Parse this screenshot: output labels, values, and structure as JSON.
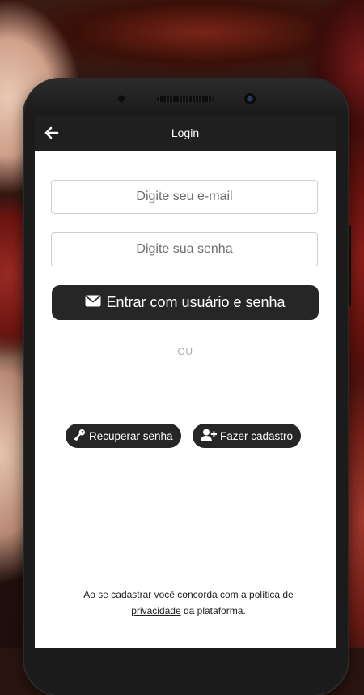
{
  "appbar": {
    "title": "Login",
    "back_icon": "arrow-left-icon"
  },
  "form": {
    "email_placeholder": "Digite seu e-mail",
    "password_placeholder": "Digite sua senha",
    "login_button": "Entrar com usuário e senha",
    "login_icon": "envelope-icon",
    "divider_text": "OU"
  },
  "actions": {
    "recover_label": "Recuperar senha",
    "recover_icon": "key-icon",
    "signup_label": "Fazer cadastro",
    "signup_icon": "user-plus-icon"
  },
  "terms": {
    "prefix": "Ao se cadastrar você concorda com a ",
    "link": "política de privacidade",
    "suffix": " da plataforma."
  },
  "colors": {
    "appbar": "#1f1f1f",
    "button": "#262626",
    "screen": "#ffffff"
  }
}
